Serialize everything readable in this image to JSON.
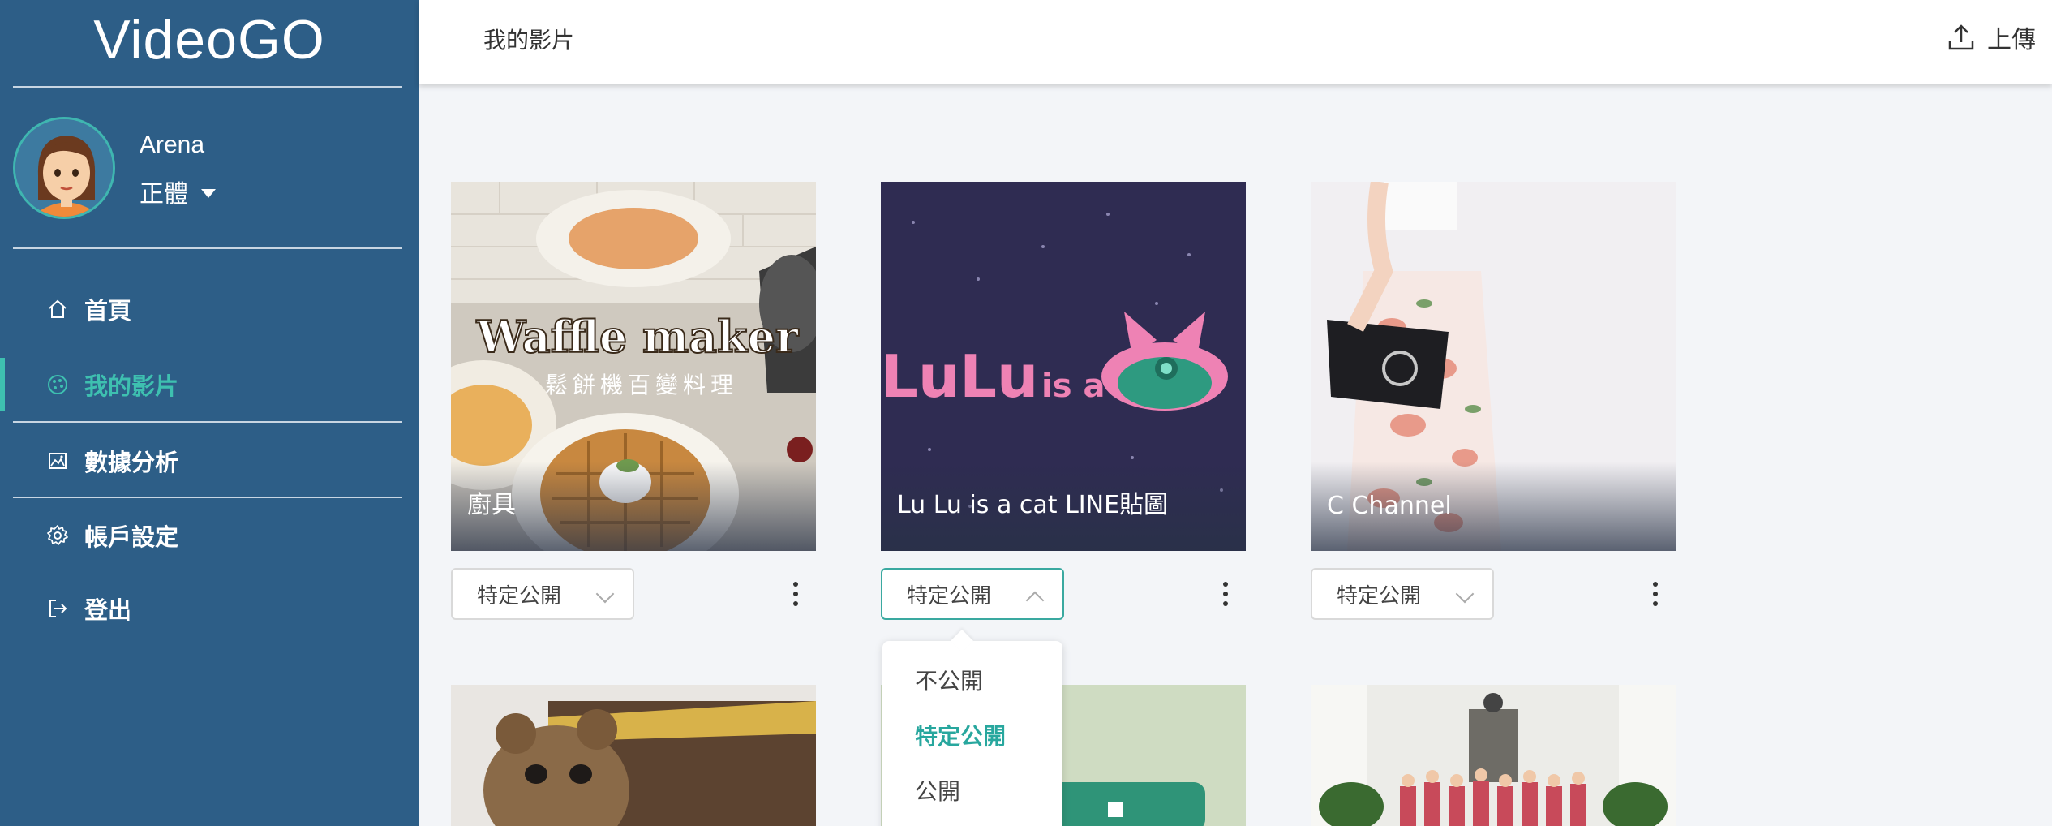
{
  "app": {
    "brand": "VideoGO"
  },
  "user": {
    "name": "Arena",
    "language": "正體"
  },
  "nav": {
    "items": [
      {
        "label": "首頁",
        "icon": "home-icon"
      },
      {
        "label": "我的影片",
        "icon": "palette-icon",
        "active": true
      },
      {
        "label": "數據分析",
        "icon": "image-chart-icon"
      },
      {
        "label": "帳戶設定",
        "icon": "gear-icon"
      },
      {
        "label": "登出",
        "icon": "logout-icon"
      }
    ]
  },
  "header": {
    "title": "我的影片",
    "upload_label": "上傳"
  },
  "videos": [
    {
      "title": "廚具",
      "thumb_text": "Waffle maker",
      "thumb_subtext": "鬆餅機百變料理",
      "visibility": "特定公開"
    },
    {
      "title": "Lu Lu is a cat LINE貼圖",
      "thumb_text": "LuLu",
      "thumb_subtext": "is a",
      "visibility": "特定公開"
    },
    {
      "title": "C Channel",
      "visibility": "特定公開"
    }
  ],
  "visibility_menu": {
    "options": [
      "不公開",
      "特定公開",
      "公開"
    ],
    "selected": "特定公開"
  },
  "colors": {
    "sidebar": "#2d5e87",
    "accent": "#3ec0b0"
  }
}
